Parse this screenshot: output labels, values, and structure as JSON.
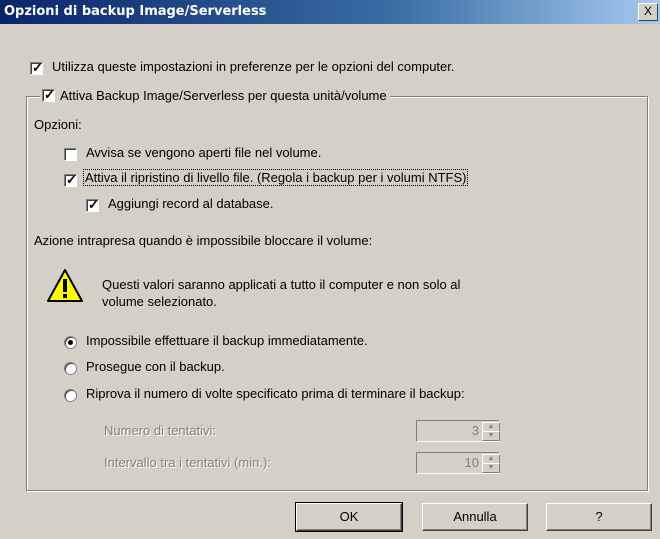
{
  "window": {
    "title": "Opzioni di backup Image/Serverless",
    "close_label": "X"
  },
  "options": {
    "use_settings_label": "Utilizza queste impostazioni in preferenze per le opzioni del computer.",
    "use_settings_checked": true,
    "enable_label": "Attiva Backup Image/Serverless per questa unità/volume",
    "enable_checked": true,
    "section_label": "Opzioni:",
    "notify_open_files_label": "Avvisa se vengono aperti file nel volume.",
    "notify_open_files_checked": false,
    "file_level_restore_label": "Attiva il ripristino di livello file. (Regola i backup per i volumi NTFS)",
    "file_level_restore_checked": true,
    "add_records_label": "Aggiungi record al database.",
    "add_records_checked": true
  },
  "lock_action": {
    "heading": "Azione intrapresa quando è impossibile bloccare il volume:",
    "warning_line1": "Questi valori saranno applicati a tutto il computer e non solo al",
    "warning_line2": "volume selezionato.",
    "radios": [
      {
        "label": "Impossibile effettuare il backup immediatamente.",
        "selected": true
      },
      {
        "label": "Prosegue con il backup.",
        "selected": false
      },
      {
        "label": "Riprova il numero di volte specificato prima di terminare il backup:",
        "selected": false
      }
    ],
    "retries_label": "Numero di tentativi:",
    "retries_value": "3",
    "interval_label": "Intervallo tra i tentativi (min.):",
    "interval_value": "10"
  },
  "buttons": {
    "ok": "OK",
    "cancel": "Annulla",
    "help": "?"
  }
}
